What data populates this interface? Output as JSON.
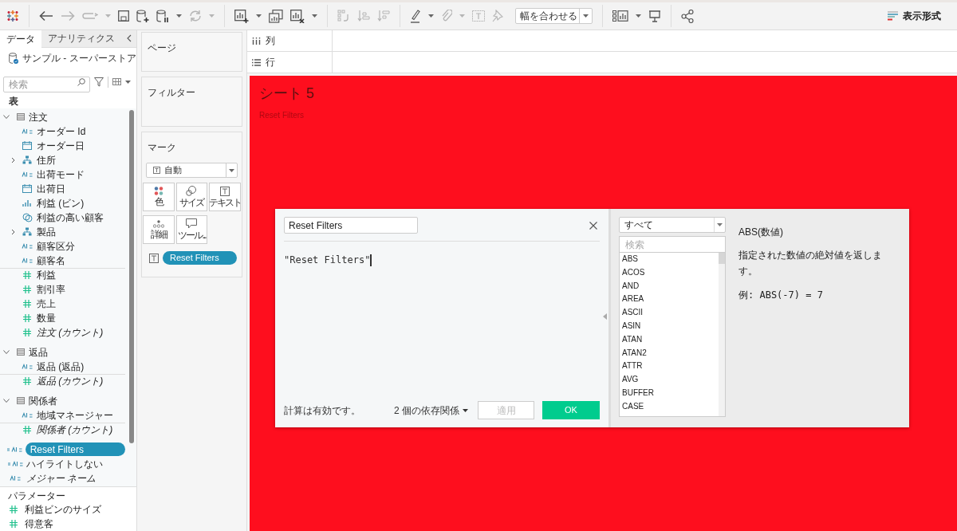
{
  "toolbar": {
    "fit_dropdown": "幅を合わせる",
    "show_me_button": "表示形式"
  },
  "data_pane": {
    "tabs": [
      {
        "label": "データ",
        "selected": true
      },
      {
        "label": "アナリティクス",
        "selected": false
      }
    ],
    "datasource": "サンプル - スーパーストア",
    "search_placeholder": "検索",
    "section_label": "表",
    "tables": [
      {
        "name": "注文",
        "expanded": true,
        "fields": [
          {
            "name": "オーダー Id",
            "kind": "abc",
            "italic": false,
            "selected": false
          },
          {
            "name": "オーダー日",
            "kind": "date",
            "italic": false,
            "selected": false
          },
          {
            "name": "住所",
            "kind": "hierarchy",
            "expanded": false,
            "italic": false,
            "selected": false
          },
          {
            "name": "出荷モード",
            "kind": "abc",
            "italic": false,
            "selected": false
          },
          {
            "name": "出荷日",
            "kind": "date",
            "italic": false,
            "selected": false
          },
          {
            "name": "利益 (ビン)",
            "kind": "bin",
            "italic": false,
            "selected": false
          },
          {
            "name": "利益の高い顧客",
            "kind": "set",
            "italic": false,
            "selected": false
          },
          {
            "name": "製品",
            "kind": "hierarchy",
            "expanded": false,
            "italic": false,
            "selected": false
          },
          {
            "name": "顧客区分",
            "kind": "abc",
            "italic": false,
            "selected": false
          },
          {
            "name": "顧客名",
            "kind": "abc",
            "italic": false,
            "selected": false
          },
          {
            "name": "利益",
            "kind": "number",
            "italic": false,
            "selected": false
          },
          {
            "name": "割引率",
            "kind": "number",
            "italic": false,
            "selected": false
          },
          {
            "name": "売上",
            "kind": "number",
            "italic": false,
            "selected": false
          },
          {
            "name": "数量",
            "kind": "number",
            "italic": false,
            "selected": false
          },
          {
            "name": "注文 (カウント)",
            "kind": "number",
            "italic": true,
            "selected": false
          }
        ]
      },
      {
        "name": "返品",
        "expanded": true,
        "fields": [
          {
            "name": "返品 (返品)",
            "kind": "abc",
            "italic": false,
            "selected": false
          },
          {
            "name": "返品 (カウント)",
            "kind": "number",
            "italic": true,
            "selected": false
          }
        ]
      },
      {
        "name": "関係者",
        "expanded": true,
        "fields": [
          {
            "name": "地域マネージャー",
            "kind": "abc",
            "italic": false,
            "selected": false
          },
          {
            "name": "関係者 (カウント)",
            "kind": "number",
            "italic": true,
            "selected": false
          }
        ]
      }
    ],
    "loose_fields": [
      {
        "name": "Reset Filters",
        "kind": "calc_abc",
        "italic": false,
        "selected": true
      },
      {
        "name": "ハイライトしない",
        "kind": "calc_abc",
        "italic": false,
        "selected": false
      },
      {
        "name": "メジャー ネーム",
        "kind": "abc",
        "italic": true,
        "selected": false
      }
    ],
    "parameters": {
      "label": "パラメーター",
      "fields": [
        {
          "name": "利益ビンのサイズ",
          "kind": "number",
          "italic": false,
          "selected": false
        },
        {
          "name": "得意客",
          "kind": "number",
          "italic": false,
          "selected": false
        }
      ]
    }
  },
  "cards": {
    "pages": "ページ",
    "filters": "フィルター",
    "marks": {
      "title": "マーク",
      "mark_type": "自動",
      "buttons": [
        {
          "label": "色",
          "kind": "color"
        },
        {
          "label": "サイズ",
          "kind": "size"
        },
        {
          "label": "テキスト",
          "kind": "text"
        },
        {
          "label": "詳細",
          "kind": "detail"
        },
        {
          "label": "ツール...",
          "kind": "tooltip"
        }
      ],
      "pills": [
        {
          "label": "Reset Filters",
          "kind": "text"
        }
      ]
    }
  },
  "shelves": {
    "columns": "列",
    "rows": "行"
  },
  "sheet": {
    "title": "シート 5",
    "subtitle": "Reset Filters"
  },
  "calc_dialog": {
    "name": "Reset Filters",
    "formula": "\"Reset Filters\"",
    "status": "計算は有効です。",
    "dependencies": "2 個の依存関係",
    "apply_button": {
      "label": "適用",
      "disabled": true
    },
    "ok_button": "OK",
    "category": "すべて",
    "search_placeholder": "検索",
    "functions": [
      "ABS",
      "ACOS",
      "AND",
      "AREA",
      "ASCII",
      "ASIN",
      "ATAN",
      "ATAN2",
      "ATTR",
      "AVG",
      "BUFFER",
      "CASE"
    ],
    "help": {
      "title": "ABS(数値)",
      "description": "指定された数値の絶対値を返します。",
      "example": "例: ABS(-7) = 7"
    }
  }
}
